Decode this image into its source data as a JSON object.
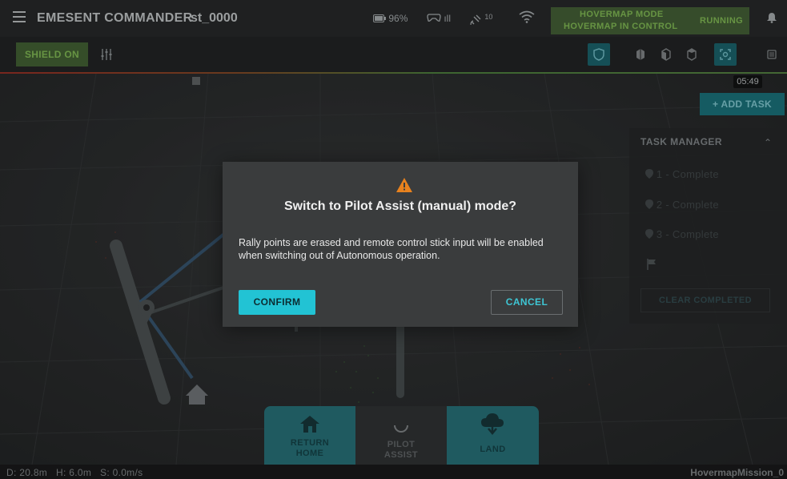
{
  "header": {
    "app_title": "EMESENT COMMANDER",
    "device_id": "st_0000",
    "battery": "96%",
    "controller_signal": "ıll",
    "satellites": "10",
    "mode_line1": "HOVERMAP MODE",
    "mode_line2": "HOVERMAP IN CONTROL",
    "status": "RUNNING"
  },
  "toolbar": {
    "shield_label": "SHIELD ON"
  },
  "map": {
    "timer": "05:49",
    "add_task_label": "+ ADD TASK"
  },
  "task_manager": {
    "title": "TASK MANAGER",
    "items": [
      {
        "label": "1 - Complete"
      },
      {
        "label": "2 - Complete"
      },
      {
        "label": "3 - Complete"
      }
    ],
    "clear_label": "CLEAR COMPLETED"
  },
  "dialog": {
    "title": "Switch to Pilot Assist (manual) mode?",
    "body": "Rally points are erased and remote control stick input will be enabled when switching out of Autonomous operation.",
    "confirm_label": "CONFIRM",
    "cancel_label": "CANCEL"
  },
  "bottom_nav": {
    "return_home_line1": "RETURN",
    "return_home_line2": "HOME",
    "pilot_assist_line1": "PILOT",
    "pilot_assist_line2": "ASSIST",
    "land_label": "LAND"
  },
  "status_bar": {
    "distance": "D: 20.8m",
    "height": "H: 6.0m",
    "speed": "S: 0.0m/s",
    "mission": "HovermapMission_0"
  },
  "colors": {
    "accent_cyan": "#22c3d4",
    "mode_green": "#8fce5e",
    "warning_orange": "#e8821e",
    "nav_teal": "#2b7d86"
  }
}
